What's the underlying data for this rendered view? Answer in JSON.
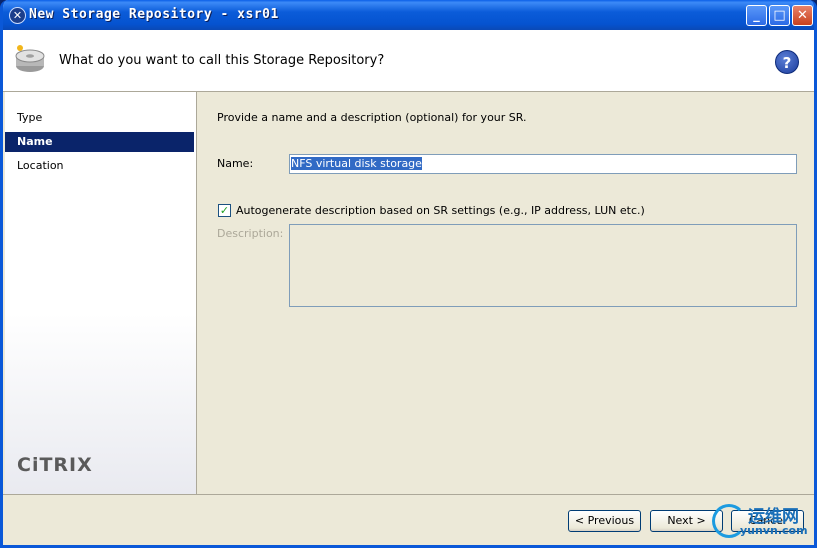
{
  "window": {
    "title": "New Storage Repository - xsr01"
  },
  "header": {
    "title": "What do you want to call this Storage Repository?"
  },
  "sidebar": {
    "items": [
      {
        "label": "Type"
      },
      {
        "label": "Name"
      },
      {
        "label": "Location"
      }
    ],
    "active_index": 1,
    "logo": "CiTRIX"
  },
  "form": {
    "intro": "Provide a name and a description (optional) for your SR.",
    "name_label": "Name:",
    "name_value": "NFS virtual disk storage",
    "autogen_label": "Autogenerate description based on SR settings (e.g., IP address, LUN etc.)",
    "autogen_checked": true,
    "description_label": "Description:",
    "description_value": ""
  },
  "footer": {
    "previous_label": "< Previous",
    "next_label": "Next >",
    "cancel_label": "Cancel"
  },
  "watermark": {
    "cn": "运维网",
    "en": "yunvn.com"
  },
  "colors": {
    "titlebar": "#0b5cd9",
    "selection": "#0a246a",
    "background": "#ece9d8"
  }
}
